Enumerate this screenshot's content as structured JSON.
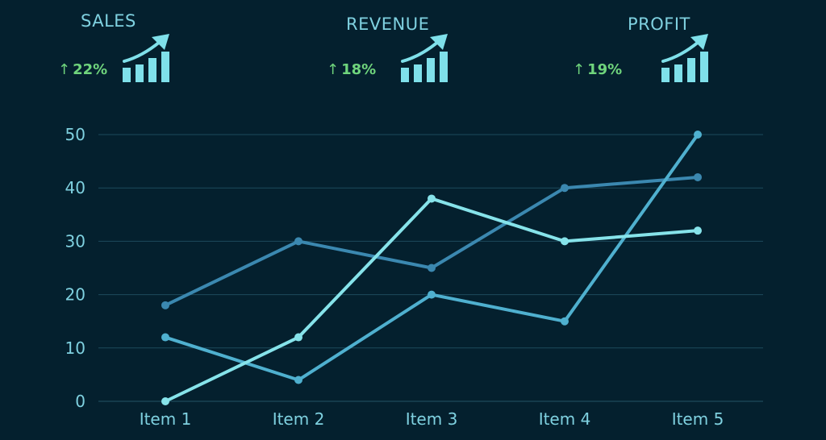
{
  "kpis": [
    {
      "title": "SALES",
      "change": "22%",
      "icon": "growth-bar-chart-icon"
    },
    {
      "title": "REVENUE",
      "change": "18%",
      "icon": "growth-bar-chart-icon"
    },
    {
      "title": "PROFIT",
      "change": "19%",
      "icon": "growth-bar-chart-icon"
    }
  ],
  "colors": {
    "background": "#04202e",
    "text": "#7fd1e0",
    "positive": "#6fd47c",
    "gridline": "#1d4a5c",
    "series": [
      "#3b88b0",
      "#4fb0cf",
      "#86e3ea"
    ],
    "icon": "#7fe0ea"
  },
  "chart_data": {
    "type": "line",
    "title": "",
    "xlabel": "",
    "ylabel": "",
    "categories": [
      "Item 1",
      "Item 2",
      "Item 3",
      "Item 4",
      "Item 5"
    ],
    "yticks": [
      0,
      10,
      20,
      30,
      40,
      50
    ],
    "ylim": [
      0,
      50
    ],
    "grid": true,
    "series": [
      {
        "values": [
          18,
          30,
          25,
          40,
          42
        ]
      },
      {
        "values": [
          12,
          4,
          20,
          15,
          50
        ]
      },
      {
        "values": [
          0,
          12,
          38,
          30,
          32
        ]
      }
    ]
  }
}
